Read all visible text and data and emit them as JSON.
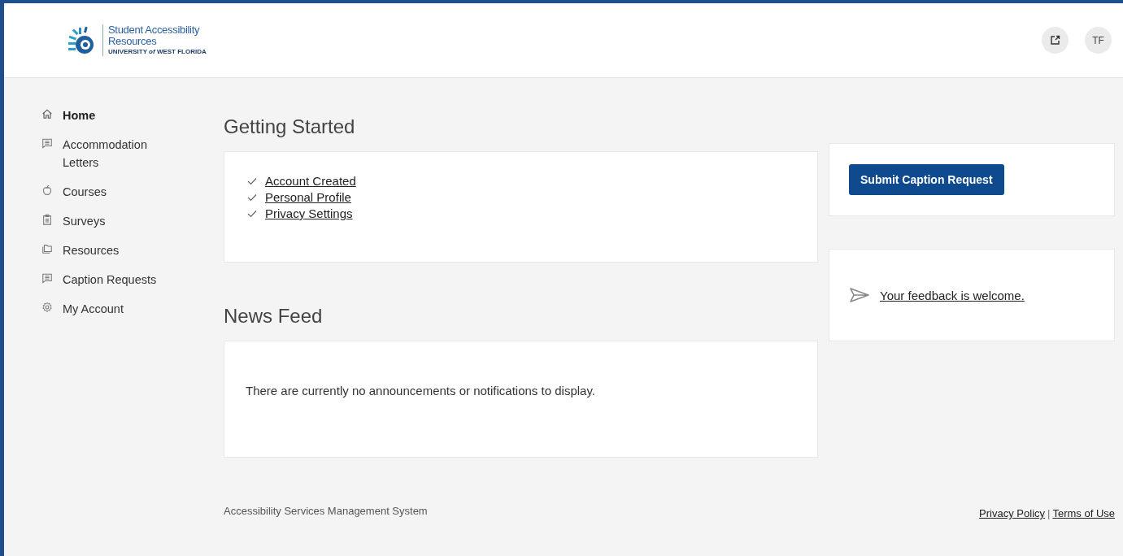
{
  "header": {
    "logo": {
      "title": "Student Accessibility",
      "subtitle": "Resources",
      "institution": "UNIVERSITY *of* WEST FLORIDA"
    },
    "avatar": "TF"
  },
  "sidebar": {
    "items": [
      {
        "label": "Home",
        "kind": "home",
        "selected": true
      },
      {
        "label": "Accommodation Letters",
        "kind": "letters",
        "selected": false
      },
      {
        "label": "Courses",
        "kind": "courses",
        "selected": false
      },
      {
        "label": "Surveys",
        "kind": "surveys",
        "selected": false
      },
      {
        "label": "Resources",
        "kind": "resources",
        "selected": false
      },
      {
        "label": "Caption Requests",
        "kind": "letters",
        "selected": false
      },
      {
        "label": "My Account",
        "kind": "account",
        "selected": false
      }
    ]
  },
  "getting_started": {
    "title": "Getting Started",
    "items": [
      {
        "label": "Account Created",
        "checked": true
      },
      {
        "label": "Personal Profile",
        "checked": true
      },
      {
        "label": "Privacy Settings",
        "checked": true
      }
    ]
  },
  "news_feed": {
    "title": "News Feed",
    "message": "There are currently no announcements or notifications to display."
  },
  "actions": {
    "button": "Submit Caption Request",
    "feedback": "Your feedback is welcome."
  },
  "footer": {
    "text": "Accessibility Services Management System",
    "links": [
      "Privacy Policy",
      "Terms of Use"
    ],
    "separator": "|"
  }
}
